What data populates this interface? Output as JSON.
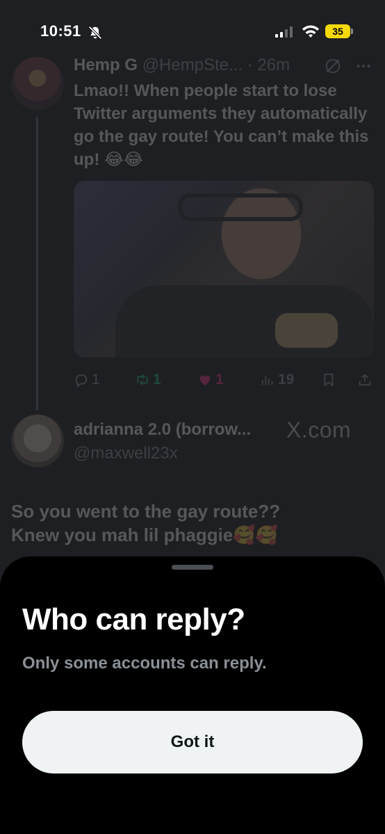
{
  "status_bar": {
    "time": "10:51",
    "battery": "35"
  },
  "tweet1": {
    "name": "Hemp G",
    "handle": "@HempSte...",
    "time": "· 26m",
    "text": "Lmao!! When people start to lose Twitter arguments they automatically go the gay route! You can’t make this up! 😂😂",
    "stats": {
      "replies": "1",
      "retweets": "1",
      "likes": "1",
      "views": "19"
    }
  },
  "tweet2": {
    "name": "adrianna 2.0 (borrow...",
    "handle": "@maxwell23x",
    "text_line1": "So you went to the gay route??",
    "text_line2": "Knew you mah lil phaggie🥰🥰"
  },
  "watermark": "X.com",
  "sheet": {
    "title": "Who can reply?",
    "subtitle": "Only some accounts can reply.",
    "button_label": "Got it"
  },
  "colors": {
    "retweet": "#00ba7c",
    "like": "#f91880",
    "battery": "#f5d90a",
    "button_bg": "#eff3f4"
  },
  "icons": [
    "bell-slash-icon",
    "signal-icon",
    "wifi-icon",
    "grok-icon",
    "more-icon",
    "reply-icon",
    "retweet-icon",
    "heart-icon",
    "views-icon",
    "bookmark-icon",
    "share-icon"
  ]
}
